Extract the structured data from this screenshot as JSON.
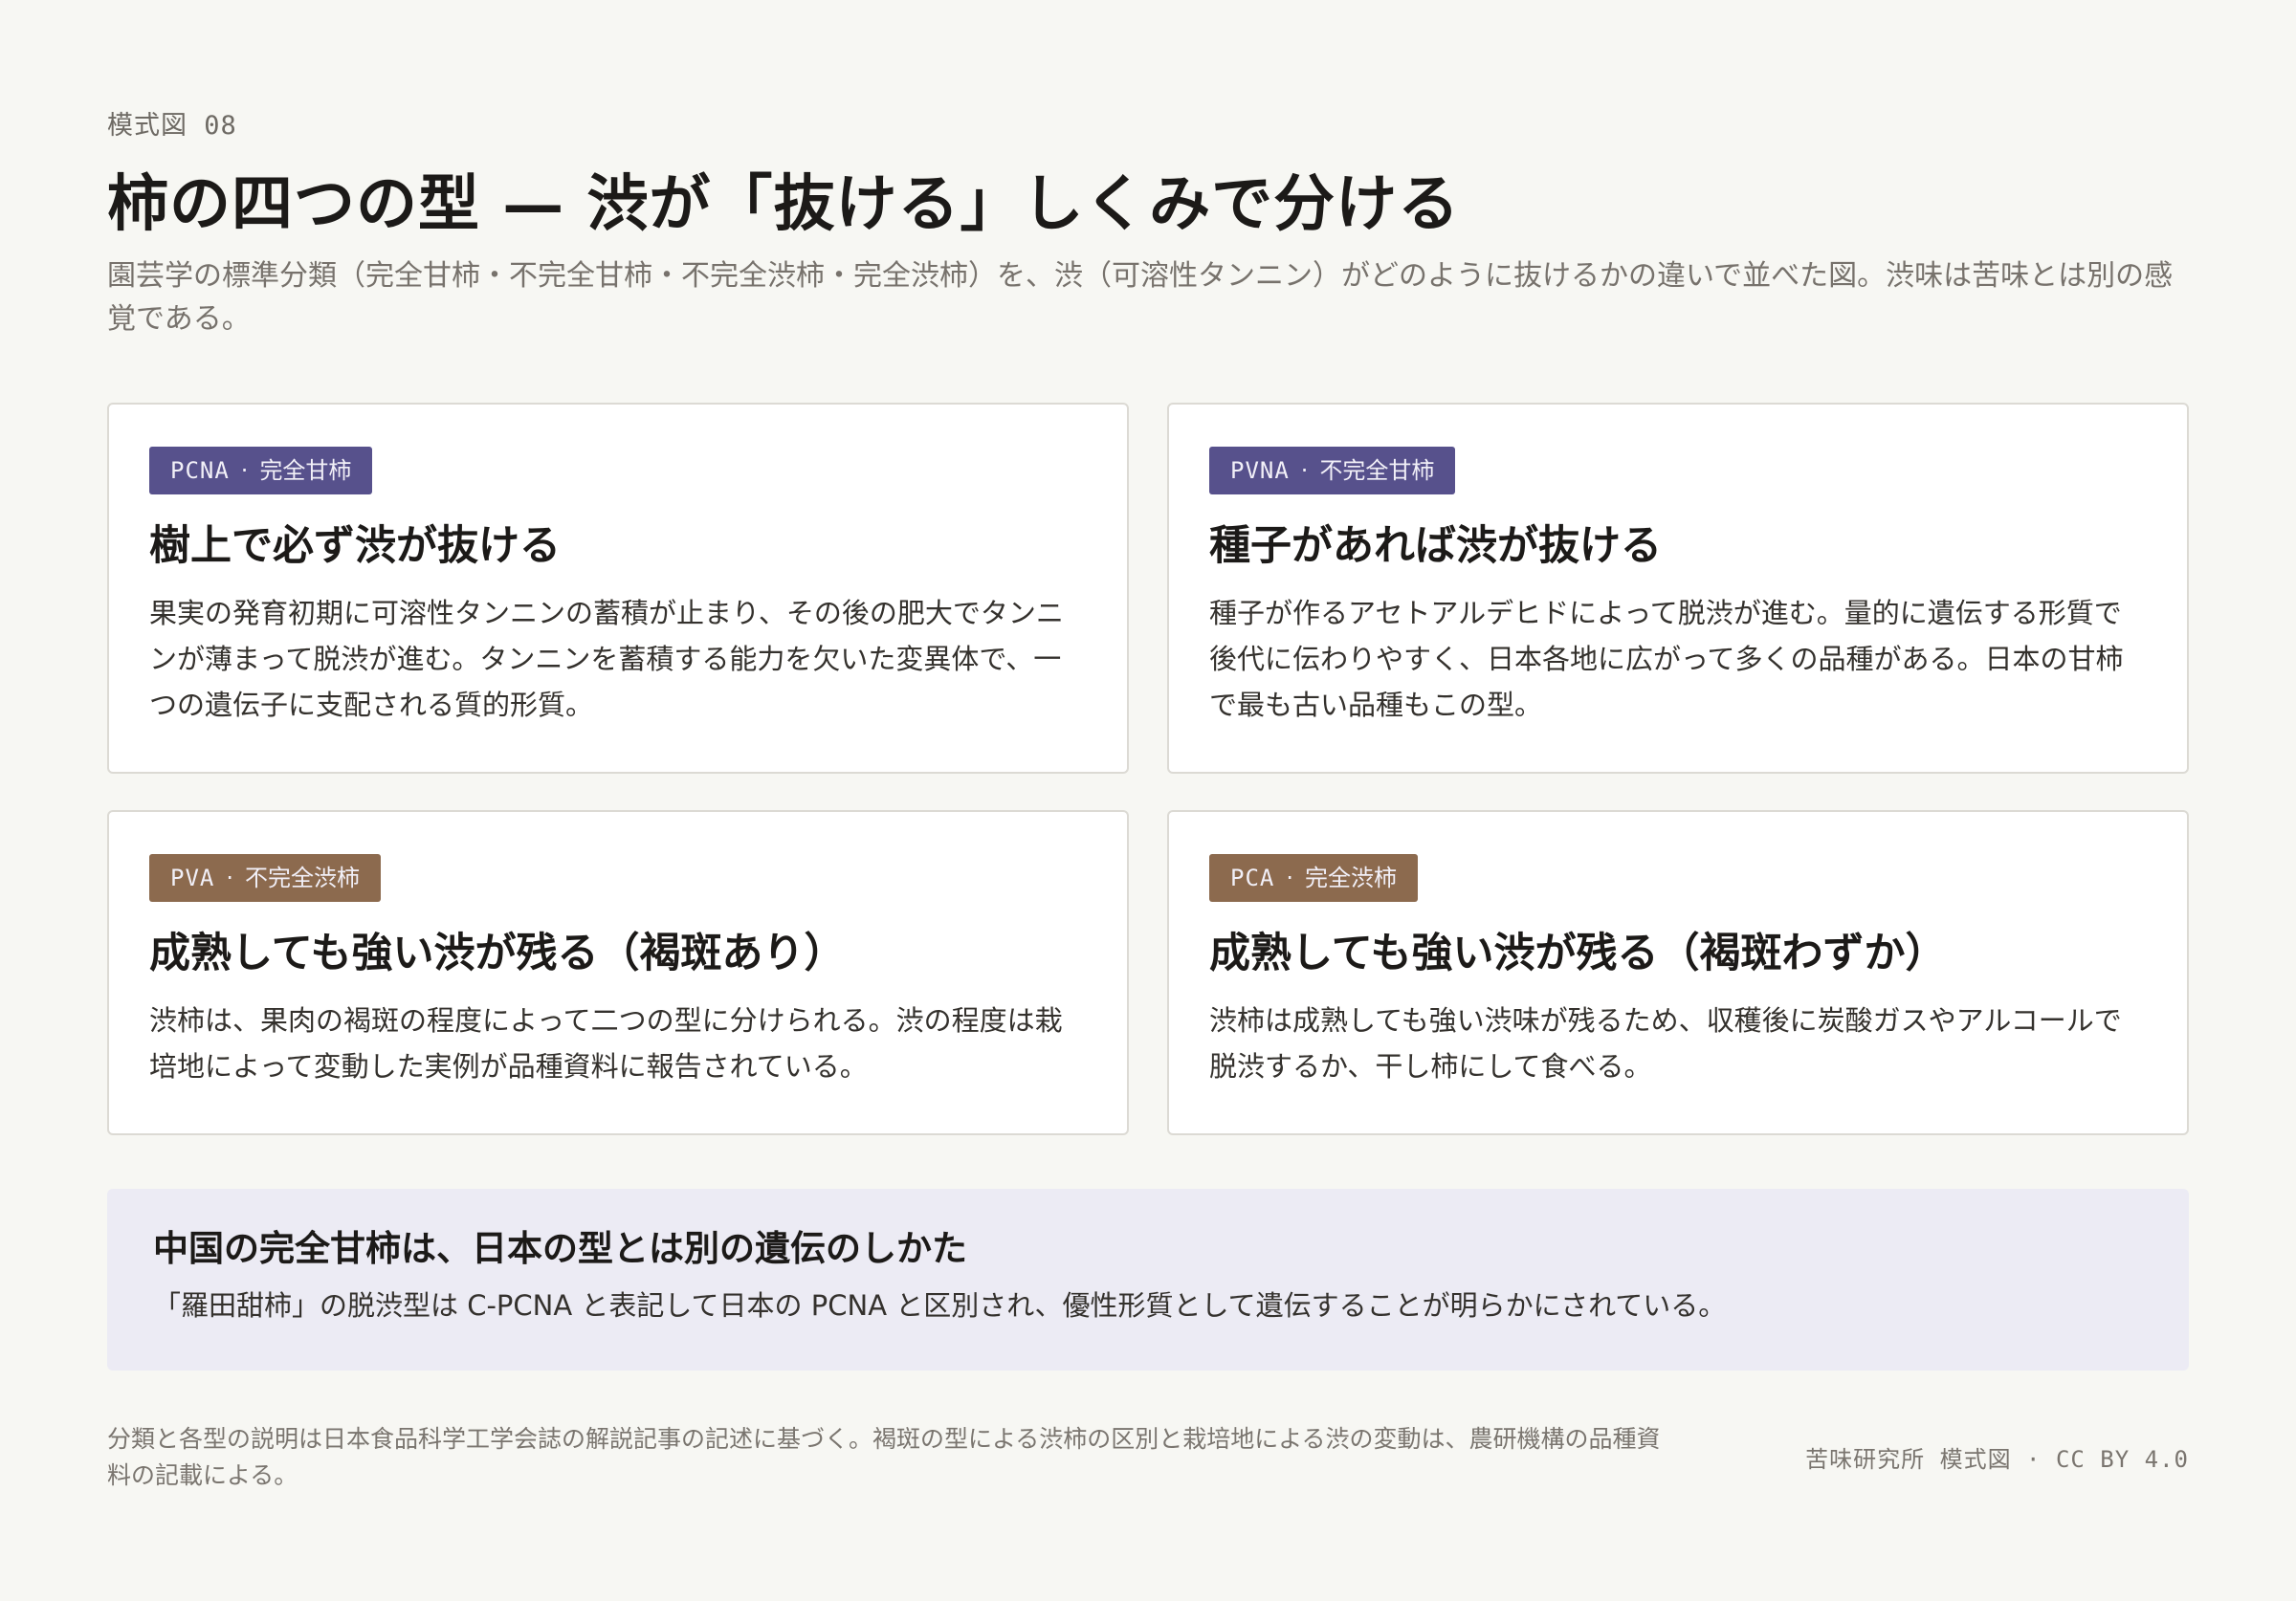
{
  "header": {
    "figure_number": "模式図 08",
    "title": "柿の四つの型 — 渋が「抜ける」しくみで分ける",
    "subtitle": "園芸学の標準分類（完全甘柿・不完全甘柿・不完全渋柿・完全渋柿）を、渋（可溶性タンニン）がどのように抜けるかの違いで並べた図。渋味は苦味とは別の感覚である。"
  },
  "colors": {
    "sweet_tag": "#57518c",
    "astringent_tag": "#8c6a4e",
    "note_background": "#ecebf4",
    "page_background": "#f7f7f3"
  },
  "cards": [
    {
      "code": "PCNA",
      "separator": "·",
      "type_name": "完全甘柿",
      "heading": "樹上で必ず渋が抜ける",
      "body": "果実の発育初期に可溶性タンニンの蓄積が止まり、その後の肥大でタンニンが薄まって脱渋が進む。タンニンを蓄積する能力を欠いた変異体で、一つの遺伝子に支配される質的形質。"
    },
    {
      "code": "PVNA",
      "separator": "·",
      "type_name": "不完全甘柿",
      "heading": "種子があれば渋が抜ける",
      "body": "種子が作るアセトアルデヒドによって脱渋が進む。量的に遺伝する形質で後代に伝わりやすく、日本各地に広がって多くの品種がある。日本の甘柿で最も古い品種もこの型。"
    },
    {
      "code": "PVA",
      "separator": "·",
      "type_name": "不完全渋柿",
      "heading": "成熟しても強い渋が残る（褐斑あり）",
      "body": "渋柿は、果肉の褐斑の程度によって二つの型に分けられる。渋の程度は栽培地によって変動した実例が品種資料に報告されている。"
    },
    {
      "code": "PCA",
      "separator": "·",
      "type_name": "完全渋柿",
      "heading": "成熟しても強い渋が残る（褐斑わずか）",
      "body": "渋柿は成熟しても強い渋味が残るため、収穫後に炭酸ガスやアルコールで脱渋するか、干し柿にして食べる。"
    }
  ],
  "note": {
    "heading": "中国の完全甘柿は、日本の型とは別の遺伝のしかた",
    "body": "「羅田甜柿」の脱渋型は C-PCNA と表記して日本の PCNA と区別され、優性形質として遺伝することが明らかにされている。"
  },
  "footer": {
    "source": "分類と各型の説明は日本食品科学工学会誌の解説記事の記述に基づく。褐斑の型による渋柿の区別と栽培地による渋の変動は、農研機構の品種資料の記載による。",
    "credit": "苦味研究所 模式図 · CC BY 4.0"
  }
}
